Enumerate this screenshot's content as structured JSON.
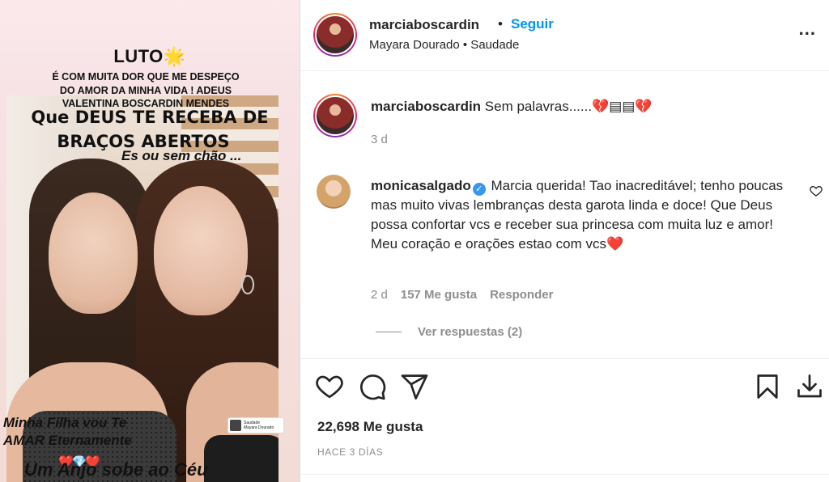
{
  "story": {
    "luto": "LUTO🌟",
    "paragraph_line1": "É COM MUITA DOR QUE ME DESPEÇO",
    "paragraph_line2": "DO AMOR DA MINHA VIDA ! ADEUS",
    "paragraph_line3": "VALENTINA BOSCARDIN   MENDES",
    "deus_line1": "Que DEUS TE RECEBA DE",
    "deus_line2": "BRAÇOS ABERTOS",
    "chao": "Es ou sem chão ...",
    "filha_line1": "Minha Filha vou  Te",
    "filha_line2": "AMAR Eternamente",
    "hearts": "❤️💎❤️",
    "anjo": "Um Anjo sobe ao Céu",
    "music_title": "Saudade",
    "music_artist": "Mayara Dourado"
  },
  "header": {
    "username": "marciaboscardin",
    "dot": "•",
    "follow": "Seguir",
    "subline": "Mayara Dourado • Saudade",
    "more": "..."
  },
  "caption": {
    "username": "marciaboscardin",
    "text": "Sem palavras......💔▤▤💔",
    "time": "3 d"
  },
  "comment": {
    "username": "monicasalgado",
    "verified": "✓",
    "text": "Marcia querida! Tao inacreditável; tenho poucas mas muito vivas lembranças desta garota linda e doce! Que Deus possa confortar vcs e receber sua princesa com muita luz e amor! Meu coração e orações estao com vcs❤️",
    "time": "2 d",
    "likes": "157 Me gusta",
    "reply": "Responder",
    "view_replies": "Ver respuestas (2)"
  },
  "actions": {
    "icons": [
      "heart-icon",
      "comment-icon",
      "share-icon",
      "bookmark-icon",
      "download-icon"
    ]
  },
  "post": {
    "likes": "22,698 Me gusta",
    "ago": "HACE 3 DÍAS"
  },
  "colors": {
    "accent": "#0095f6",
    "muted": "#8e8e8e",
    "text": "#262626"
  }
}
